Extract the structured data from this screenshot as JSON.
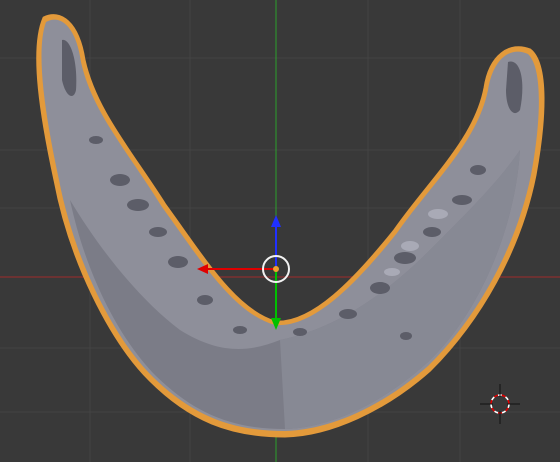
{
  "viewport": {
    "background": "#393939",
    "grid_color": "#444444",
    "axis_x_color": "#8c2e2e",
    "axis_y_color": "#2f8f2f",
    "axis_z_color": "#2b3fff"
  },
  "selected_object": {
    "name": "mandible-mesh",
    "fill_color": "#8e8f9a",
    "shadow_color": "#6f707a",
    "highlight_color": "#a2a3ae",
    "outline_color": "#e39a3b"
  },
  "transform_gizmo": {
    "x_handle_color": "#e00000",
    "y_handle_color": "#00c000",
    "z_handle_color": "#2030ff",
    "origin_color": "#f0a030"
  },
  "cursor_3d": {
    "ring_color_a": "#ffffff",
    "ring_color_b": "#e00000"
  }
}
